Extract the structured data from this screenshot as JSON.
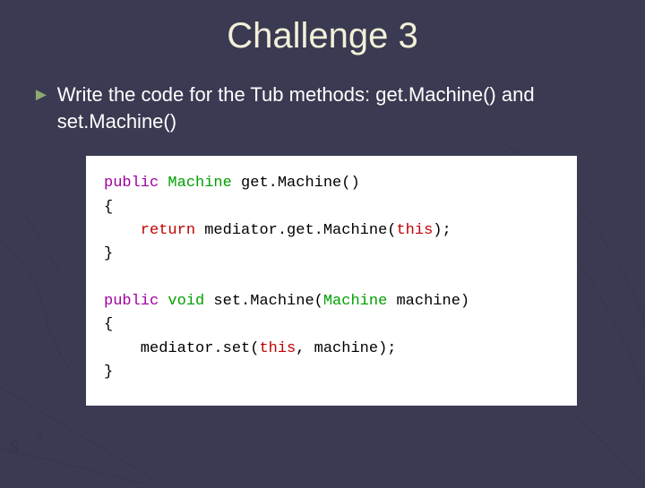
{
  "title": "Challenge 3",
  "bullet": "Write the code for the Tub methods: get.Machine() and set.Machine()",
  "code": {
    "l1a": "public",
    "l1b": " Machine",
    "l1c": " get.Machine()",
    "l2": "{",
    "l3a": "    return",
    "l3b": " mediator.get.Machine(",
    "l3c": "this",
    "l3d": ");",
    "l4": "}",
    "l5": "",
    "l6a": "public",
    "l6b": " void",
    "l6c": " set.Machine(",
    "l6d": "Machine",
    "l6e": " machine)",
    "l7": "{",
    "l8a": "    mediator.set(",
    "l8b": "this",
    "l8c": ", machine);",
    "l9": "}"
  }
}
